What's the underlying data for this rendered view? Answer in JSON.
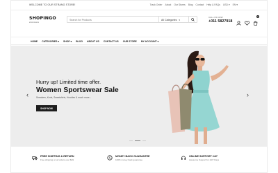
{
  "topbar": {
    "welcome": "WELCOME TO OUR STRANG STORE!",
    "links": [
      "Track Order",
      "About",
      "Our Stores",
      "Blog",
      "Contact",
      "Help & FAQs",
      "USD ▾",
      "EN ▾"
    ]
  },
  "header": {
    "logo": "SHOPINGO",
    "logo_sub": "eCommerce",
    "search_placeholder": "Search for Products",
    "category_select": "All Categories",
    "call_label": "CALL US NOW",
    "phone": "+011 5827918",
    "cart_count": "0"
  },
  "nav": {
    "items": [
      "HOME",
      "CATEGORIES ▾",
      "SHOP ▾",
      "BLOG",
      "ABOUT US",
      "CONTACT US",
      "OUR STORE",
      "MY ACCOUNT ▾"
    ]
  },
  "hero": {
    "kicker": "Hurry up! Limited time offer.",
    "title": "Women Sportswear Sale",
    "subtitle": "Sneakers, Keds, Sweatshirts, Hoodies & much more...",
    "button": "SHOP NOW"
  },
  "features": [
    {
      "title": "FREE SHIPPING & RETURN",
      "sub": "Free shipping on all orders over $49",
      "icon": "truck-icon"
    },
    {
      "title": "MONEY BACK GUARANTEE",
      "sub": "100% money back guarantee",
      "icon": "money-icon"
    },
    {
      "title": "ONLINE SUPPORT 24/7",
      "sub": "Awesome Support for 24/7 Days",
      "icon": "headset-icon"
    }
  ],
  "colors": {
    "accent": "#1d1d1d",
    "hero_bg": "#ededed",
    "dress": "#8fd3cf"
  }
}
